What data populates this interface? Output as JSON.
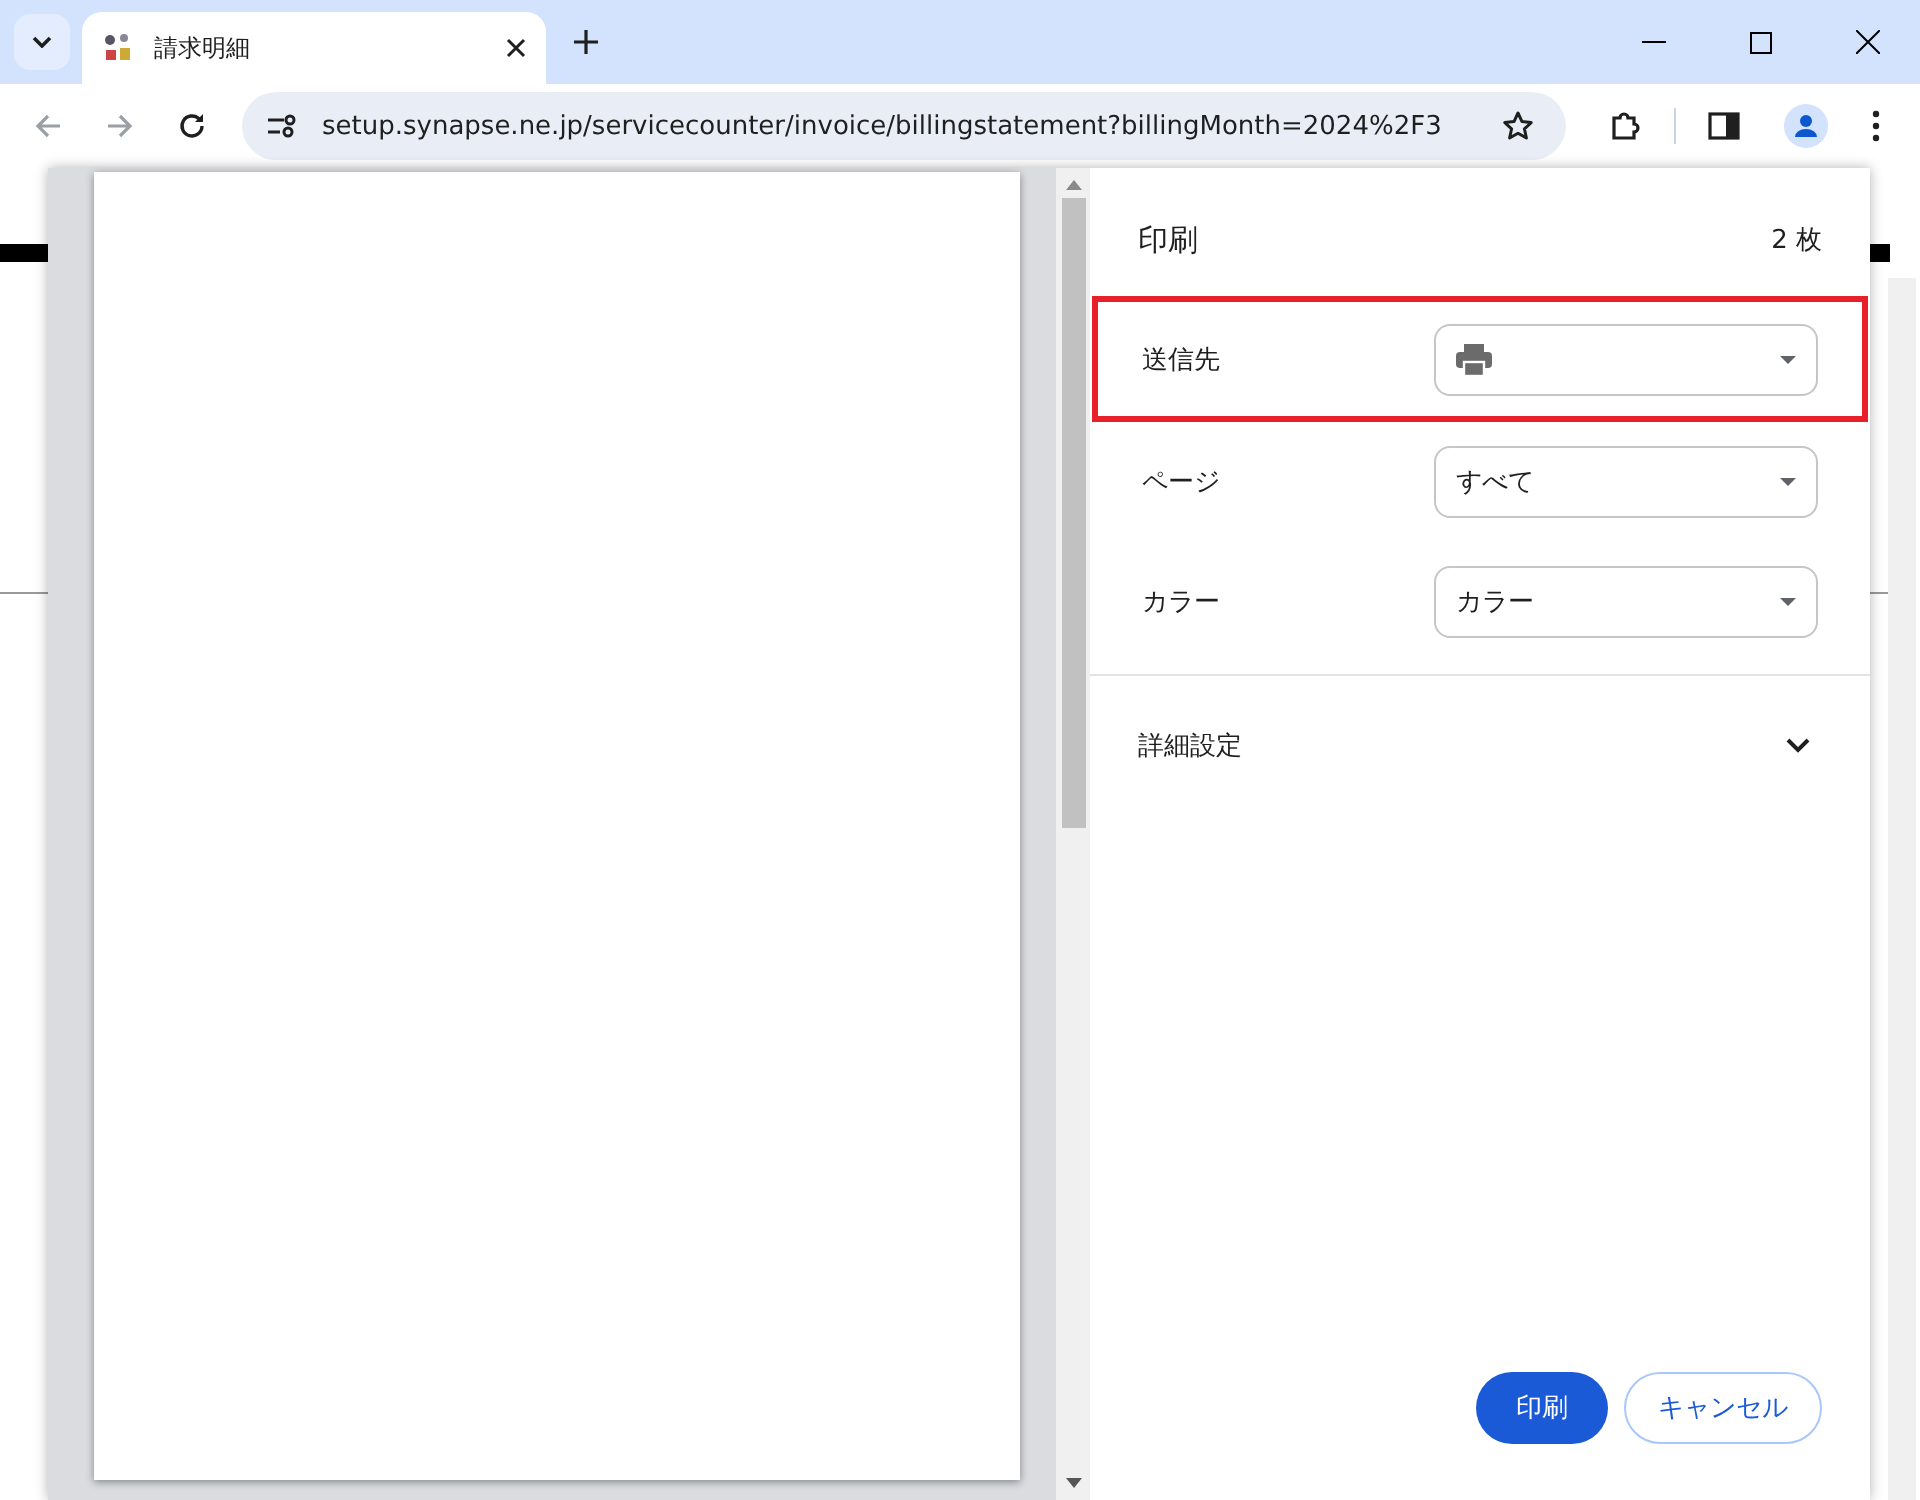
{
  "browser": {
    "tab": {
      "title": "請求明細"
    },
    "address": "setup.synapse.ne.jp/servicecounter/invoice/billingstatement?billingMonth=2024%2F3"
  },
  "print_dialog": {
    "title": "印刷",
    "sheet_count": "2 枚",
    "settings": [
      {
        "label": "送信先",
        "kind": "printer",
        "highlighted": true
      },
      {
        "label": "ページ",
        "kind": "select",
        "value": "すべて",
        "highlighted": false
      },
      {
        "label": "カラー",
        "kind": "select",
        "value": "カラー",
        "highlighted": false
      }
    ],
    "more_settings": {
      "label": "詳細設定",
      "expanded": false
    },
    "buttons": [
      {
        "label": "印刷",
        "kind": "primary"
      },
      {
        "label": "キャンセル",
        "kind": "secondary"
      }
    ]
  }
}
